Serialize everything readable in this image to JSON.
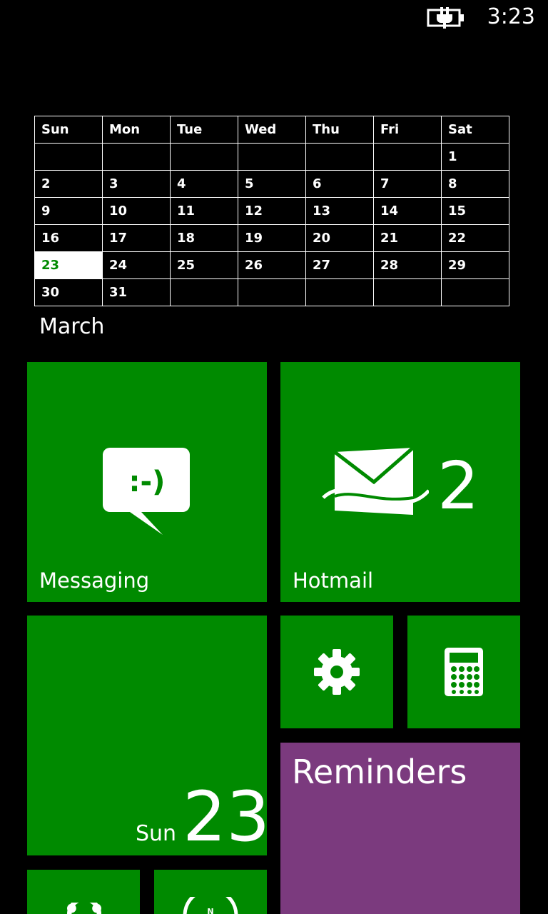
{
  "status_bar": {
    "time": "3:23",
    "battery_icon": "battery-charging-icon"
  },
  "calendar": {
    "weekdays": [
      "Sun",
      "Mon",
      "Tue",
      "Wed",
      "Thu",
      "Fri",
      "Sat"
    ],
    "weeks": [
      [
        "",
        "",
        "",
        "",
        "",
        "",
        "1"
      ],
      [
        "2",
        "3",
        "4",
        "5",
        "6",
        "7",
        "8"
      ],
      [
        "9",
        "10",
        "11",
        "12",
        "13",
        "14",
        "15"
      ],
      [
        "16",
        "17",
        "18",
        "19",
        "20",
        "21",
        "22"
      ],
      [
        "23",
        "24",
        "25",
        "26",
        "27",
        "28",
        "29"
      ],
      [
        "30",
        "31",
        "",
        "",
        "",
        "",
        ""
      ]
    ],
    "today": "23",
    "month": "March",
    "today_color": "#008a00"
  },
  "tiles": {
    "accent": "#008a00",
    "messaging": {
      "label": "Messaging",
      "icon": "messaging-icon",
      "emoticon": ":-)"
    },
    "hotmail": {
      "label": "Hotmail",
      "icon": "mail-icon",
      "count": "2"
    },
    "settings": {
      "icon": "gear-icon"
    },
    "calculator": {
      "icon": "calculator-icon"
    },
    "date": {
      "day": "Sun",
      "number": "23"
    },
    "reminders": {
      "title": "Reminders",
      "color": "#7b3a7e"
    },
    "alarms": {
      "icon": "alarm-clock-icon"
    },
    "compass": {
      "icon": "compass-icon",
      "north_label": "N"
    }
  }
}
